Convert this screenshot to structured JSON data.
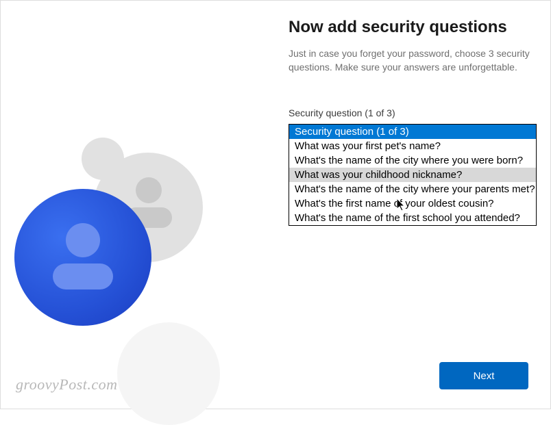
{
  "heading": "Now add security questions",
  "subheading": "Just in case you forget your password, choose 3 security questions. Make sure your answers are unforgettable.",
  "field_label": "Security question (1 of 3)",
  "dropdown": {
    "options": [
      "Security question (1 of 3)",
      "What was your first pet's name?",
      "What's the name of the city where you were born?",
      "What was your childhood nickname?",
      "What's the name of the city where your parents met?",
      "What's the first name of your oldest cousin?",
      "What's the name of the first school you attended?"
    ],
    "selected_index": 0,
    "hovered_index": 3
  },
  "next_button": "Next",
  "watermark": "groovyPost.com"
}
